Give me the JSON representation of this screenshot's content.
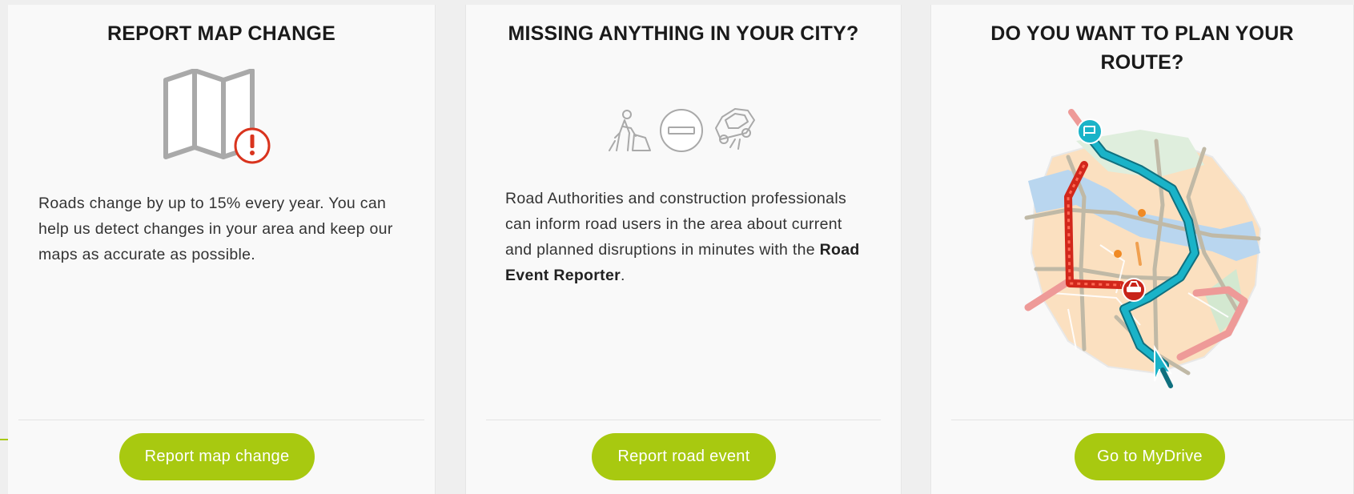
{
  "cards": [
    {
      "title": "REPORT MAP CHANGE",
      "icon": "map-alert-icon",
      "body": "Roads change by up to 15% every year. You can help us detect changes in your area and keep our maps as accurate as possible.",
      "button_label": "Report map change"
    },
    {
      "title": "MISSING ANYTHING IN YOUR CITY?",
      "icons": [
        "roadwork-icon",
        "no-entry-icon",
        "accident-icon"
      ],
      "body_before": "Road Authorities and construction professionals can inform road users in the area about current and planned disruptions in minutes with the ",
      "body_bold": "Road Event Reporter",
      "body_after": ".",
      "button_label": "Report road event"
    },
    {
      "title": "DO YOU WANT TO PLAN YOUR ROUTE?",
      "icon": "route-map-illustration",
      "button_label": "Go to MyDrive"
    }
  ],
  "colors": {
    "accent": "#a8c910",
    "alert_red": "#d9341e",
    "route_cyan": "#1ab3c8",
    "traffic_red": "#d2271b"
  }
}
